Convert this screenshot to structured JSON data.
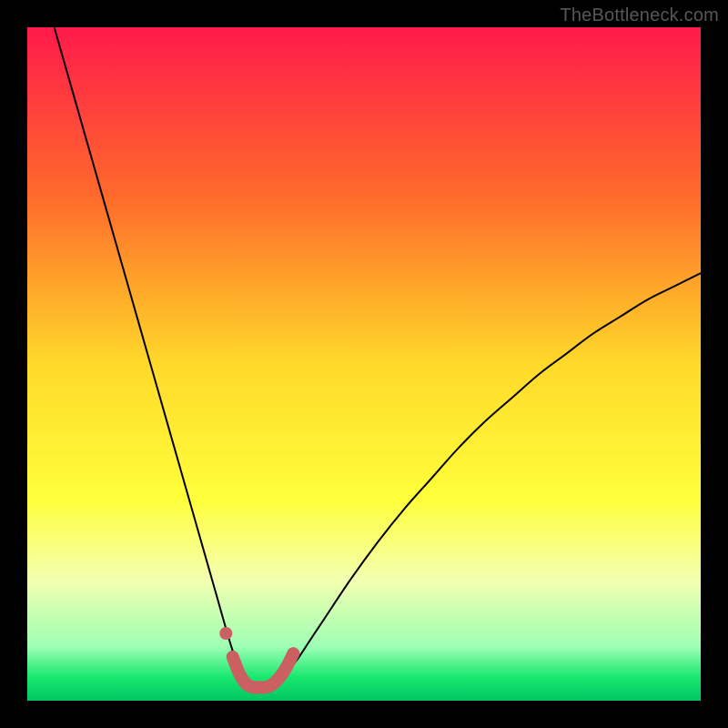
{
  "watermark": "TheBottleneck.com",
  "chart_data": {
    "type": "line",
    "title": "",
    "xlabel": "",
    "ylabel": "",
    "xlim": [
      0,
      100
    ],
    "ylim": [
      0,
      100
    ],
    "gradient_stops": [
      {
        "offset": 0,
        "color": "#ff1a4b"
      },
      {
        "offset": 0.25,
        "color": "#ff6a2b"
      },
      {
        "offset": 0.5,
        "color": "#ffd92a"
      },
      {
        "offset": 0.7,
        "color": "#ffff3a"
      },
      {
        "offset": 0.82,
        "color": "#f4ffb0"
      },
      {
        "offset": 0.92,
        "color": "#9dffb4"
      },
      {
        "offset": 0.965,
        "color": "#18e86f"
      },
      {
        "offset": 1.0,
        "color": "#00c561"
      }
    ],
    "series": [
      {
        "name": "bottleneck-curve",
        "type": "line",
        "stroke": "#000000",
        "stroke_width": 2,
        "x": [
          4,
          6,
          8,
          10,
          12,
          14,
          16,
          18,
          20,
          22,
          24,
          26,
          28,
          30,
          31,
          32,
          33,
          34,
          35,
          36,
          37,
          38,
          40,
          42,
          44,
          48,
          52,
          56,
          60,
          64,
          68,
          72,
          76,
          80,
          84,
          88,
          92,
          96,
          100
        ],
        "y": [
          100,
          93,
          86,
          79,
          72,
          65,
          58,
          51,
          44,
          37,
          30,
          23,
          16,
          9,
          6,
          4,
          2.5,
          2,
          2,
          2,
          2.5,
          3.5,
          6,
          9,
          12,
          18,
          23.5,
          28.5,
          33,
          37.5,
          41.5,
          45,
          48.5,
          51.5,
          54.5,
          57,
          59.5,
          61.5,
          63.5
        ]
      },
      {
        "name": "highlight-left-dot",
        "type": "scatter",
        "stroke": "#cb6062",
        "fill": "#cb6062",
        "radius": 7,
        "x": [
          29.5
        ],
        "y": [
          10
        ]
      },
      {
        "name": "highlight-valley",
        "type": "line",
        "stroke": "#cb6062",
        "stroke_width": 14,
        "linecap": "round",
        "x": [
          30.5,
          31.5,
          32.5,
          33.5,
          34.5,
          35.5,
          36.5,
          37.5,
          38.5,
          39.5
        ],
        "y": [
          6.5,
          4,
          2.5,
          2,
          2,
          2,
          2.5,
          3.5,
          5,
          7
        ]
      }
    ]
  }
}
